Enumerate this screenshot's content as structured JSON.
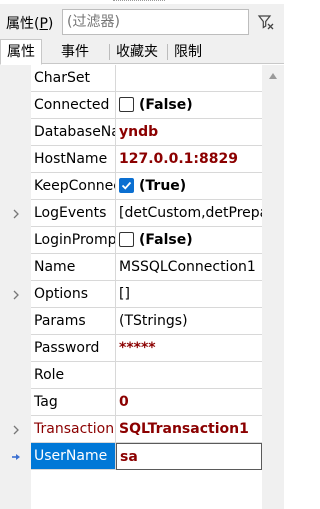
{
  "filter": {
    "label": "属性(",
    "label_accel": "P",
    "label_end": ")",
    "placeholder": "(过滤器)"
  },
  "tabs": [
    "属性",
    "事件",
    "收藏夹",
    "限制"
  ],
  "rows": [
    {
      "name": "CharSet",
      "value": "",
      "expandable": false
    },
    {
      "name": "Connected",
      "value": "(False)",
      "checkbox": true,
      "checked": false
    },
    {
      "name": "DatabaseName",
      "value": "yndb",
      "bold": true,
      "red": true
    },
    {
      "name": "HostName",
      "value": "127.0.0.1:8829",
      "bold": true,
      "red": true
    },
    {
      "name": "KeepConnection",
      "value": "(True)",
      "checkbox": true,
      "checked": true
    },
    {
      "name": "LogEvents",
      "value": "[detCustom,detPrepare]",
      "expandable": true
    },
    {
      "name": "LoginPrompt",
      "value": "(False)",
      "checkbox": true,
      "checked": false
    },
    {
      "name": "Name",
      "value": "MSSQLConnection1"
    },
    {
      "name": "Options",
      "value": "[]",
      "expandable": true
    },
    {
      "name": "Params",
      "value": "(TStrings)"
    },
    {
      "name": "Password",
      "value": "*****",
      "bold": true,
      "red": true
    },
    {
      "name": "Role",
      "value": ""
    },
    {
      "name": "Tag",
      "value": "0",
      "bold": true,
      "red": true
    },
    {
      "name": "Transaction",
      "value": "SQLTransaction1",
      "bold": true,
      "red": true,
      "name_red": true,
      "expandable": true
    },
    {
      "name": "UserName",
      "value": "sa",
      "bold": true,
      "red": true,
      "selected": true
    }
  ],
  "icons": {
    "filter_clear": "funnel-clear-icon",
    "expand": "chevron-right-icon",
    "current": "current-row-arrow-icon",
    "scroll_up": "triangle-up-icon"
  },
  "colors": {
    "selection": "#0078d7",
    "modified_value": "#8b0000",
    "checkbox_checked": "#0b6fd1"
  }
}
